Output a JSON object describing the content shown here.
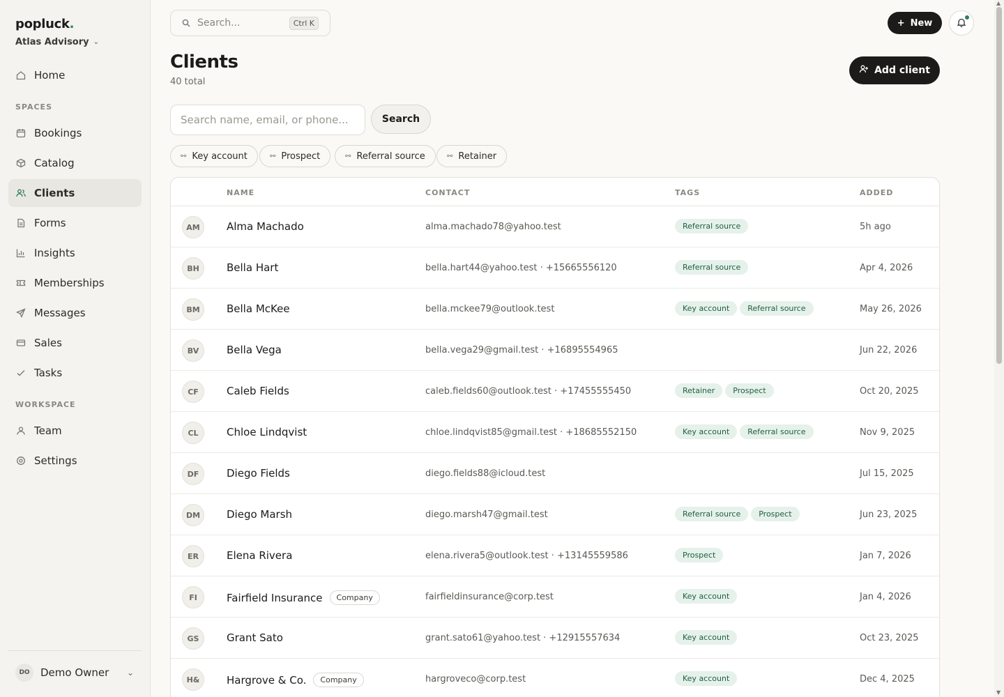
{
  "app": {
    "brand": "popluck",
    "brand_dot": ".",
    "org": "Atlas Advisory"
  },
  "sidebar": {
    "home": "Home",
    "spaces_label": "SPACES",
    "spaces": [
      "Bookings",
      "Catalog",
      "Clients",
      "Forms",
      "Insights",
      "Memberships",
      "Messages",
      "Sales",
      "Tasks"
    ],
    "workspace_label": "WORKSPACE",
    "workspace": [
      "Team",
      "Settings"
    ],
    "owner": {
      "initials": "DO",
      "name": "Demo Owner"
    }
  },
  "topbar": {
    "search_placeholder": "Search...",
    "shortcut": "Ctrl K",
    "new_label": "New"
  },
  "page": {
    "title": "Clients",
    "subtitle": "40 total",
    "add_label": "Add client"
  },
  "filters": {
    "search_placeholder": "Search name, email, or phone...",
    "search_button": "Search",
    "chips": [
      "Key account",
      "Prospect",
      "Referral source",
      "Retainer"
    ]
  },
  "table": {
    "headers": {
      "name": "NAME",
      "contact": "CONTACT",
      "tags": "TAGS",
      "added": "ADDED"
    },
    "rows": [
      {
        "initials": "AM",
        "name": "Alma Machado",
        "badge": "",
        "contact": "alma.machado78@yahoo.test",
        "tags": [
          "Referral source"
        ],
        "added": "5h ago"
      },
      {
        "initials": "BH",
        "name": "Bella Hart",
        "badge": "",
        "contact": "bella.hart44@yahoo.test · +15665556120",
        "tags": [
          "Referral source"
        ],
        "added": "Apr 4, 2026"
      },
      {
        "initials": "BM",
        "name": "Bella McKee",
        "badge": "",
        "contact": "bella.mckee79@outlook.test",
        "tags": [
          "Key account",
          "Referral source"
        ],
        "added": "May 26, 2026"
      },
      {
        "initials": "BV",
        "name": "Bella Vega",
        "badge": "",
        "contact": "bella.vega29@gmail.test · +16895554965",
        "tags": [],
        "added": "Jun 22, 2026"
      },
      {
        "initials": "CF",
        "name": "Caleb Fields",
        "badge": "",
        "contact": "caleb.fields60@outlook.test · +17455555450",
        "tags": [
          "Retainer",
          "Prospect"
        ],
        "added": "Oct 20, 2025"
      },
      {
        "initials": "CL",
        "name": "Chloe Lindqvist",
        "badge": "",
        "contact": "chloe.lindqvist85@gmail.test · +18685552150",
        "tags": [
          "Key account",
          "Referral source"
        ],
        "added": "Nov 9, 2025"
      },
      {
        "initials": "DF",
        "name": "Diego Fields",
        "badge": "",
        "contact": "diego.fields88@icloud.test",
        "tags": [],
        "added": "Jul 15, 2025"
      },
      {
        "initials": "DM",
        "name": "Diego Marsh",
        "badge": "",
        "contact": "diego.marsh47@gmail.test",
        "tags": [
          "Referral source",
          "Prospect"
        ],
        "added": "Jun 23, 2025"
      },
      {
        "initials": "ER",
        "name": "Elena Rivera",
        "badge": "",
        "contact": "elena.rivera5@outlook.test · +13145559586",
        "tags": [
          "Prospect"
        ],
        "added": "Jan 7, 2026"
      },
      {
        "initials": "FI",
        "name": "Fairfield Insurance",
        "badge": "Company",
        "contact": "fairfieldinsurance@corp.test",
        "tags": [
          "Key account"
        ],
        "added": "Jan 4, 2026"
      },
      {
        "initials": "GS",
        "name": "Grant Sato",
        "badge": "",
        "contact": "grant.sato61@yahoo.test · +12915557634",
        "tags": [
          "Key account"
        ],
        "added": "Oct 23, 2025"
      },
      {
        "initials": "H&",
        "name": "Hargrove & Co.",
        "badge": "Company",
        "contact": "hargroveco@corp.test",
        "tags": [
          "Key account"
        ],
        "added": "Dec 4, 2025"
      }
    ]
  },
  "colors": {
    "accent": "#2e7d5b",
    "tag_bg": "#e5f1ea",
    "tag_text": "#1f5e43",
    "primary_button": "#1c1b19"
  }
}
